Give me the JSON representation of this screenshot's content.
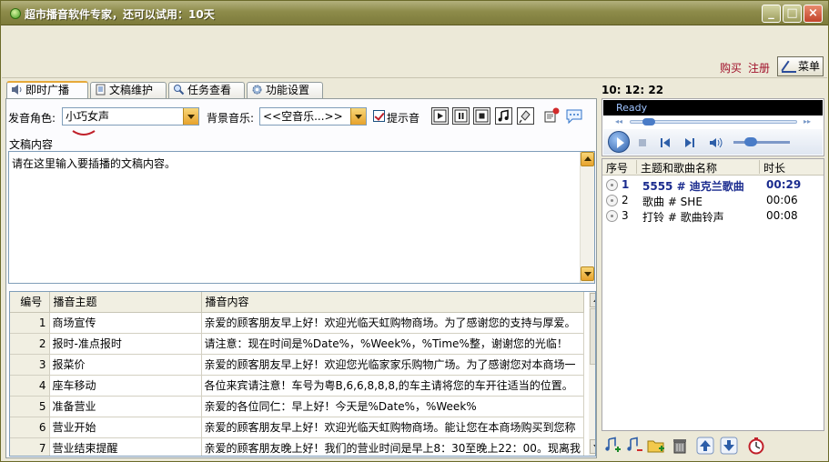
{
  "window": {
    "title": "超市播音软件专家，还可以试用：10天",
    "minimize": "_",
    "maximize": "□",
    "close": "×"
  },
  "header": {
    "buy_label": "购买",
    "register_label": "注册",
    "menu_label": "菜单"
  },
  "tabs": [
    {
      "label": "即时广播",
      "icon": "speaker-icon",
      "active": true
    },
    {
      "label": "文稿维护",
      "icon": "document-icon",
      "active": false
    },
    {
      "label": "任务查看",
      "icon": "magnifier-icon",
      "active": false
    },
    {
      "label": "功能设置",
      "icon": "gear-icon",
      "active": false
    }
  ],
  "broadcast": {
    "voice_label": "发音角色:",
    "voice_value": "小巧女声",
    "bgm_label": "背景音乐:",
    "bgm_value": "<<空音乐...>>",
    "prompt_label": "提示音",
    "prompt_checked": true,
    "content_label": "文稿内容",
    "content_text": "请在这里输入要插播的文稿内容。"
  },
  "table": {
    "columns": [
      "编号",
      "播音主题",
      "播音内容"
    ],
    "rows": [
      {
        "no": "1",
        "topic": "商场宣传",
        "content": "亲爱的顾客朋友早上好！欢迎光临天虹购物商场。为了感谢您的支持与厚爱。"
      },
      {
        "no": "2",
        "topic": "报时-准点报时",
        "content": "请注意：现在时间是%Date%，%Week%，%Time%整，谢谢您的光临！"
      },
      {
        "no": "3",
        "topic": "报菜价",
        "content": "亲爱的顾客朋友早上好！欢迎您光临家家乐购物广场。为了感谢您对本商场一"
      },
      {
        "no": "4",
        "topic": "座车移动",
        "content": "各位来宾请注意！车号为粤B,6,6,8,8,8,的车主请将您的车开往适当的位置。"
      },
      {
        "no": "5",
        "topic": "准备营业",
        "content": "亲爱的各位同仁：早上好！今天是%Date%，%Week%"
      },
      {
        "no": "6",
        "topic": "营业开始",
        "content": "亲爱的顾客朋友早上好！欢迎光临天虹购物商场。能让您在本商场购买到您称"
      },
      {
        "no": "7",
        "topic": "营业结束提醒",
        "content": "亲爱的顾客朋友晚上好！我们的营业时间是早上8：30至晚上22：00。现离我"
      }
    ]
  },
  "player": {
    "clock": "10: 12: 22",
    "status": "Ready"
  },
  "playlist": {
    "columns": [
      "序号",
      "主题和歌曲名称",
      "时长"
    ],
    "rows": [
      {
        "no": "1",
        "title": "5555 # 迪克兰歌曲",
        "duration": "00:29",
        "current": true
      },
      {
        "no": "2",
        "title": "歌曲 # SHE",
        "duration": "00:06",
        "current": false
      },
      {
        "no": "3",
        "title": "打铃 # 歌曲铃声",
        "duration": "00:08",
        "current": false
      }
    ]
  },
  "colors": {
    "titlebar": "#8d8b4a",
    "link_red": "#a0102a",
    "current_track": "#1a2b8e",
    "accent_orange": "#e7a22c"
  }
}
